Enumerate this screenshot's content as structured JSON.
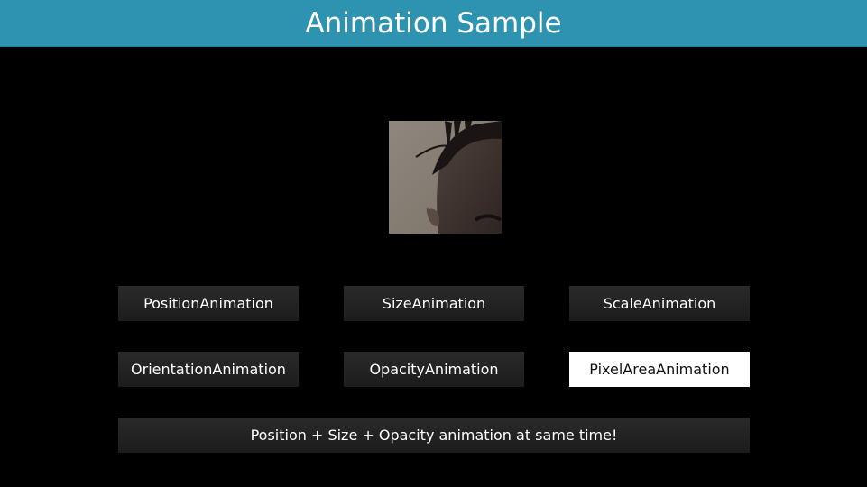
{
  "header": {
    "title": "Animation Sample",
    "color": "#2d93b0"
  },
  "image": {
    "icon": "face-photo"
  },
  "buttons": [
    {
      "label": "PositionAnimation",
      "selected": false
    },
    {
      "label": "SizeAnimation",
      "selected": false
    },
    {
      "label": "ScaleAnimation",
      "selected": false
    },
    {
      "label": "OrientationAnimation",
      "selected": false
    },
    {
      "label": "OpacityAnimation",
      "selected": false
    },
    {
      "label": "PixelAreaAnimation",
      "selected": true
    }
  ],
  "combined_button": {
    "label": "Position + Size + Opacity animation at same time!"
  }
}
